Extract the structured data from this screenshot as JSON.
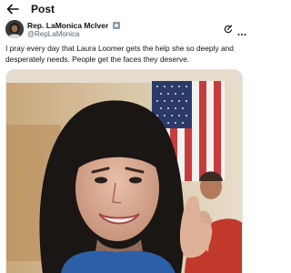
{
  "header": {
    "title": "Post",
    "back_icon": "back-arrow-icon"
  },
  "author": {
    "name": "Rep. LaMonica McIver",
    "handle": "@RepLaMonica",
    "verified_badge_icon": "government-badge-icon",
    "grok_icon": "grok-icon",
    "more_icon": "more-icon"
  },
  "tweet": {
    "text": "I pray every day that Laura Loomer gets the help she so deeply and desperately needs. People get the faces they deserve."
  },
  "media": {
    "kind": "photo"
  },
  "colors": {
    "text": "#0f1419",
    "muted": "#536471",
    "badge": "#829aab"
  }
}
